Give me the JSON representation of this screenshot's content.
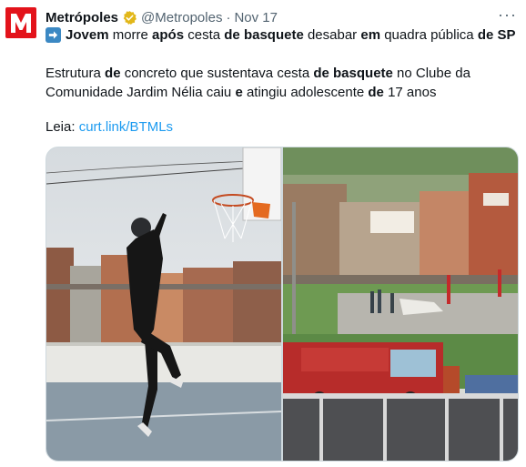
{
  "author": {
    "name": "Metrópoles",
    "handle": "@Metropoles",
    "separator": "·",
    "date": "Nov 17",
    "avatar_color": "#e3131b",
    "verified_badge": "gold-check-icon"
  },
  "more_label": "···",
  "headline": {
    "emoji": "right-arrow-icon",
    "w1": "Jovem",
    "w2": "morre",
    "w3": "após",
    "w4": "cesta",
    "w5": "de basquete",
    "w6": "desabar",
    "w7": "em",
    "w8": "quadra pública",
    "w9": "de SP"
  },
  "body": {
    "p1": "Estrutura ",
    "p2": "de",
    "p3": " concreto que sustentava cesta ",
    "p4": "de basquete",
    "p5": " no Clube da Comunidade Jardim Nélia caiu ",
    "p6": "e",
    "p7": " atingiu adolescente ",
    "p8": "de",
    "p9": " 17 anos"
  },
  "leia_label": "Leia:",
  "link_text": "curt.link/BTMLs",
  "colors": {
    "link": "#1d9bf0",
    "muted": "#536471",
    "border": "#cfd9de"
  }
}
